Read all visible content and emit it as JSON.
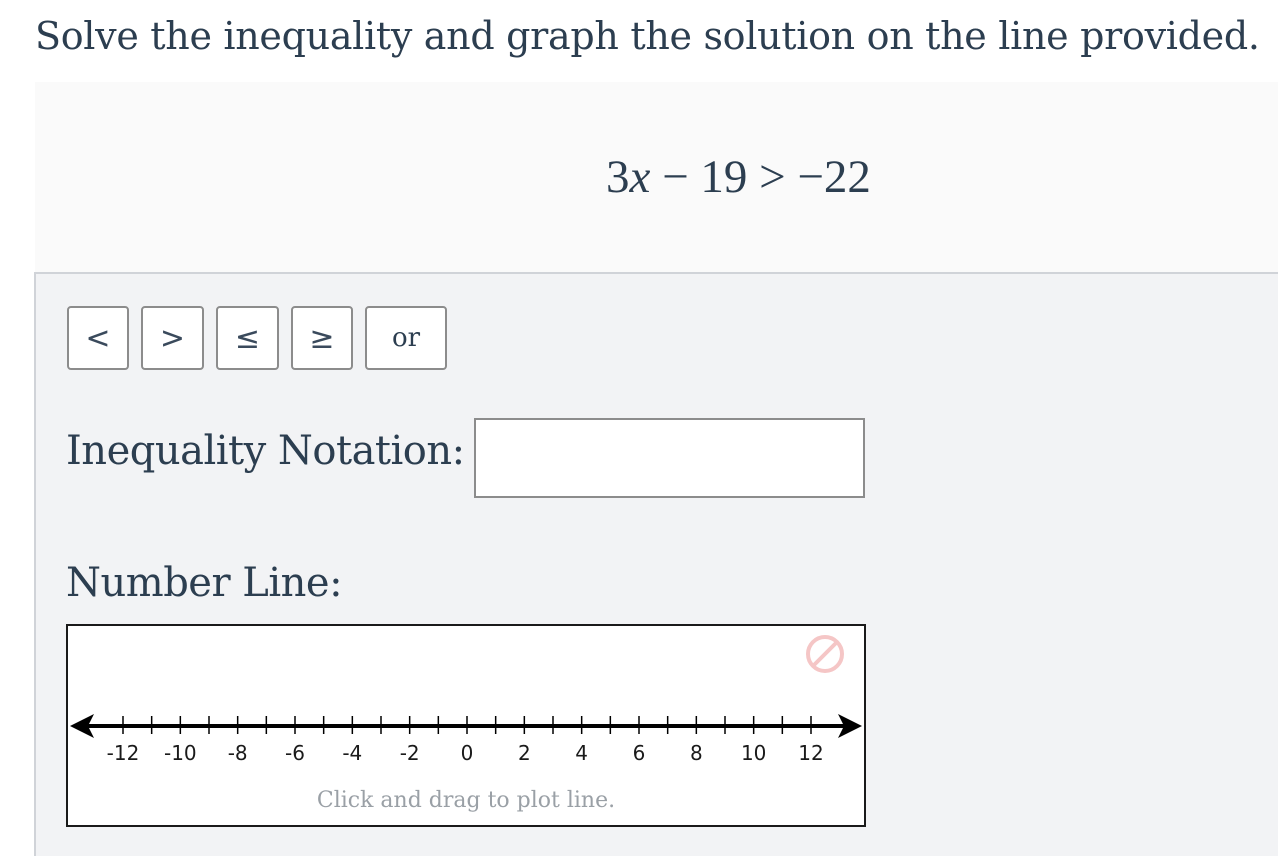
{
  "prompt": "Solve the inequality and graph the solution on the line provided.",
  "equation": {
    "coef": "3",
    "var": "x",
    "rest": " − 19 > −22"
  },
  "symbol_buttons": [
    {
      "label": "<",
      "name": "less-than-button"
    },
    {
      "label": ">",
      "name": "greater-than-button"
    },
    {
      "label": "≤",
      "name": "less-equal-button"
    },
    {
      "label": "≥",
      "name": "greater-equal-button"
    },
    {
      "label": "or",
      "name": "or-button"
    }
  ],
  "inequality_notation": {
    "label": "Inequality Notation:",
    "value": "",
    "placeholder": ""
  },
  "number_line": {
    "label": "Number Line:",
    "hint": "Click and drag to plot line.",
    "min": -13,
    "max": 13,
    "labeled_ticks": [
      -12,
      -10,
      -8,
      -6,
      -4,
      -2,
      0,
      2,
      4,
      6,
      8,
      10,
      12
    ],
    "clear_icon": "no-entry-icon",
    "clear_icon_color": "#f5c6c6"
  },
  "colors": {
    "text": "#2c3e50",
    "panel_bg": "#f2f3f5",
    "border": "#8c8c8c"
  }
}
